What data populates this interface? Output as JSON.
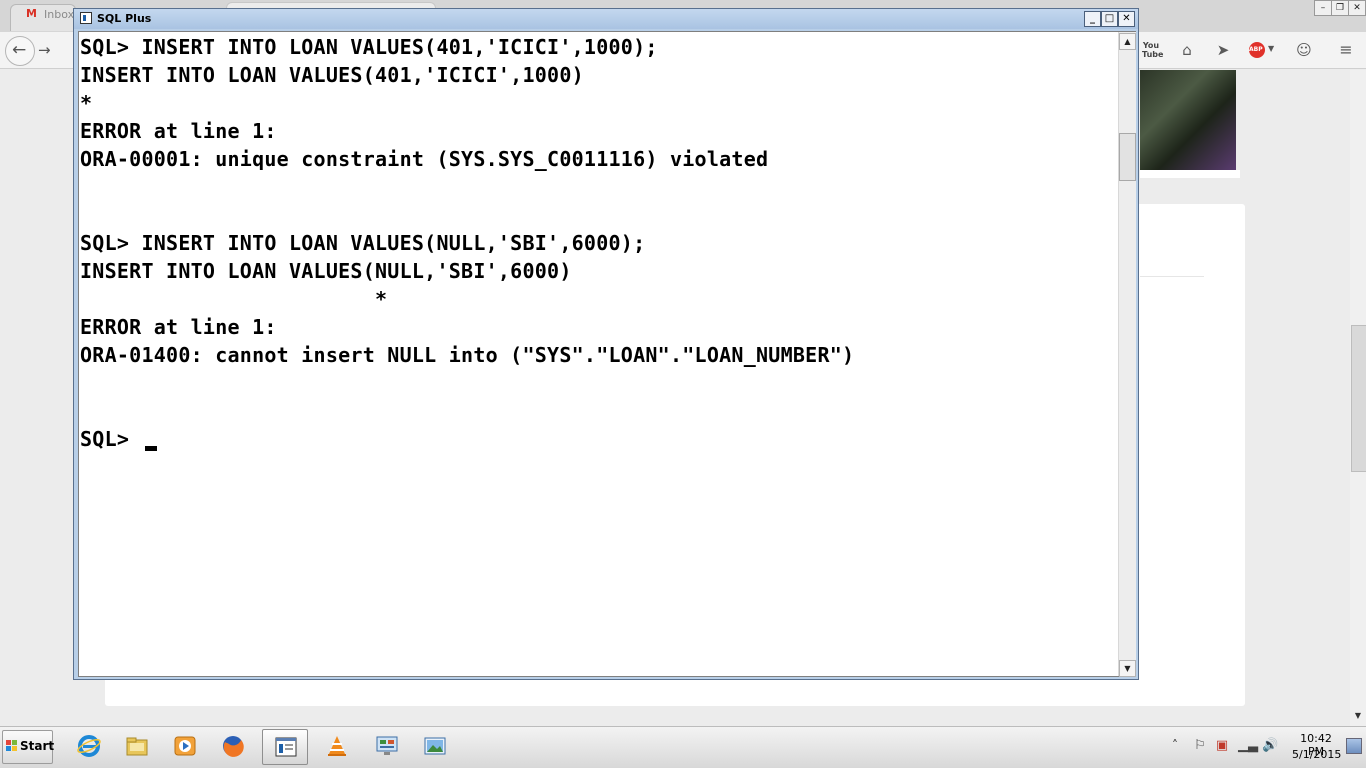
{
  "browser": {
    "tab_title": "Inbox"
  },
  "sqlplus": {
    "title": "SQL Plus",
    "console_lines": [
      "SQL> INSERT INTO LOAN VALUES(401,'ICICI',1000);",
      "INSERT INTO LOAN VALUES(401,'ICICI',1000)",
      "*",
      "ERROR at line 1:",
      "ORA-00001: unique constraint (SYS.SYS_C0011116) violated",
      "",
      "",
      "SQL> INSERT INTO LOAN VALUES(NULL,'SBI',6000);",
      "INSERT INTO LOAN VALUES(NULL,'SBI',6000)",
      "                        *",
      "ERROR at line 1:",
      "ORA-01400: cannot insert NULL into (\"SYS\".\"LOAN\".\"LOAN_NUMBER\")",
      "",
      "",
      "SQL> "
    ]
  },
  "taskbar": {
    "start_label": "Start",
    "clock_time": "10:42 PM",
    "clock_date": "5/1/2015",
    "buttons": [
      "internet-explorer",
      "file-explorer",
      "media-player",
      "firefox",
      "sql-plus",
      "vlc",
      "control-panel",
      "photo-viewer"
    ]
  },
  "icons": {
    "back": "arrow-left-icon",
    "forward": "arrow-right-icon",
    "youtube": "youtube-icon",
    "home": "home-icon",
    "send": "send-icon",
    "adblock": "adblock-plus-icon",
    "chat": "chat-icon",
    "menu": "hamburger-menu-icon"
  },
  "colors": {
    "console_text": "#000000",
    "console_bg": "#ffffff",
    "window_frame": "#b8cfe8"
  }
}
